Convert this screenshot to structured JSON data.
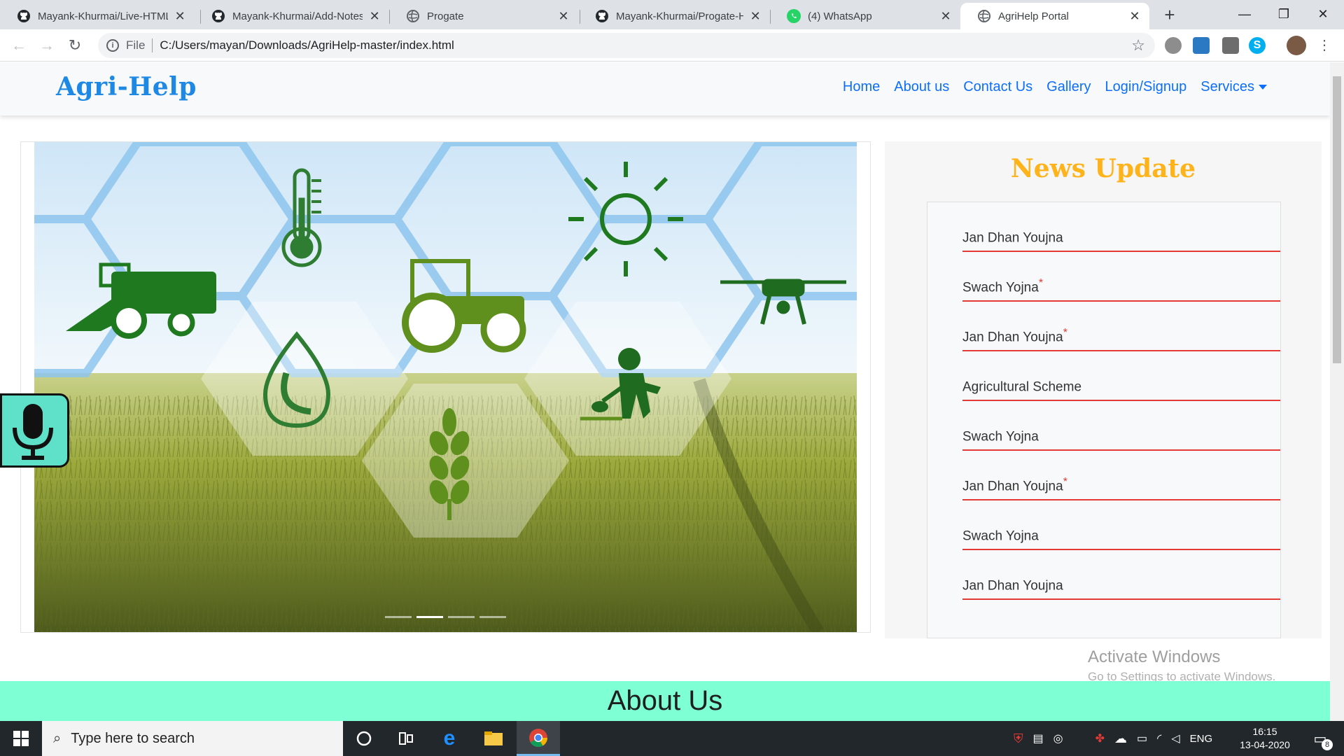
{
  "browser": {
    "tabs": [
      {
        "title": "Mayank-Khurmai/Live-HTML",
        "icon": "github-icon"
      },
      {
        "title": "Mayank-Khurmai/Add-Notes",
        "icon": "github-icon"
      },
      {
        "title": "Progate",
        "icon": "globe-icon"
      },
      {
        "title": "Mayank-Khurmai/Progate-H",
        "icon": "github-icon"
      },
      {
        "title": "(4) WhatsApp",
        "icon": "whatsapp-icon"
      },
      {
        "title": "AgriHelp Portal",
        "icon": "globe-icon"
      }
    ],
    "active_tab_index": 5,
    "new_tab": "+",
    "address": {
      "scheme": "File",
      "url": "C:/Users/mayan/Downloads/AgriHelp-master/index.html"
    }
  },
  "site": {
    "brand": "Agri-Help",
    "nav": [
      "Home",
      "About us",
      "Contact Us",
      "Gallery",
      "Login/Signup",
      "Services"
    ],
    "carousel": {
      "slides": 4,
      "active_index": 1
    },
    "news": {
      "title": "News Update",
      "items": [
        {
          "text": "Jan Dhan Youjna",
          "star": ""
        },
        {
          "text": "Swach Yojna",
          "star": "*"
        },
        {
          "text": "Jan Dhan Youjna",
          "star": "*"
        },
        {
          "text": "Agricultural Scheme",
          "star": ""
        },
        {
          "text": "Swach Yojna",
          "star": ""
        },
        {
          "text": "Jan Dhan Youjna",
          "star": "*"
        },
        {
          "text": "Swach Yojna",
          "star": ""
        },
        {
          "text": "Jan Dhan Youjna",
          "star": ""
        }
      ]
    },
    "about_heading": "About Us",
    "watermark": {
      "line1": "Activate Windows",
      "line2": "Go to Settings to activate Windows."
    }
  },
  "taskbar": {
    "search_placeholder": "Type here to search",
    "language": "ENG",
    "time": "16:15",
    "date": "13-04-2020",
    "notifications": "8"
  },
  "colors": {
    "brand": "#1e88e5",
    "link": "#0d6efd",
    "news_title": "#ffb31a",
    "news_divider": "#e53935",
    "about_bg": "#7fffd4",
    "mic_bg": "#5fe0c8",
    "icon_green": "#1f7a1f"
  }
}
